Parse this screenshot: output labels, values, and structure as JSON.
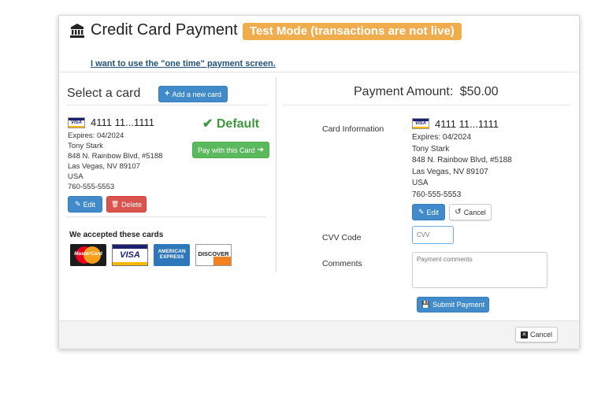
{
  "header": {
    "title": "Credit Card Payment",
    "test_badge": "Test Mode (transactions are not live)",
    "one_time_link": "I want to use the \"one time\" payment screen."
  },
  "left": {
    "select_title": "Select a card",
    "add_card_label": "Add a new card",
    "card": {
      "brand": "VISA",
      "number": "4111 11...1111",
      "expires": "Expires: 04/2024",
      "name": "Tony Stark",
      "address1": "848 N. Rainbow Blvd, #5188",
      "address2": "Las Vegas, NV 89107",
      "country": "USA",
      "phone": "760-555-5553"
    },
    "default_label": "Default",
    "pay_label": "Pay with this Card",
    "edit_label": "Edit",
    "delete_label": "Delete",
    "accepted_title": "We accepted these cards",
    "accepted_logos": [
      "MasterCard",
      "VISA",
      "AMERICAN EXPRESS",
      "DISCOVER"
    ]
  },
  "right": {
    "amount_label": "Payment Amount:",
    "amount_value": "$50.00",
    "card_info_label": "Card Information",
    "card": {
      "brand": "VISA",
      "number": "4111 11...1111",
      "expires": "Expires: 04/2024",
      "name": "Tony Stark",
      "address1": "848 N. Rainbow Blvd, #5188",
      "address2": "Las Vegas, NV 89107",
      "country": "USA",
      "phone": "760-555-5553"
    },
    "edit_label": "Edit",
    "cancel_label": "Cancel",
    "cvv_label": "CVV Code",
    "cvv_placeholder": "CVV",
    "comments_label": "Comments",
    "comments_placeholder": "Payment comments",
    "submit_label": "Submit Payment"
  },
  "footer": {
    "cancel_label": "Cancel"
  },
  "colors": {
    "primary": "#428bca",
    "success": "#5cb85c",
    "danger": "#d9534f",
    "warning": "#f0ad4e",
    "link": "#23527c"
  }
}
